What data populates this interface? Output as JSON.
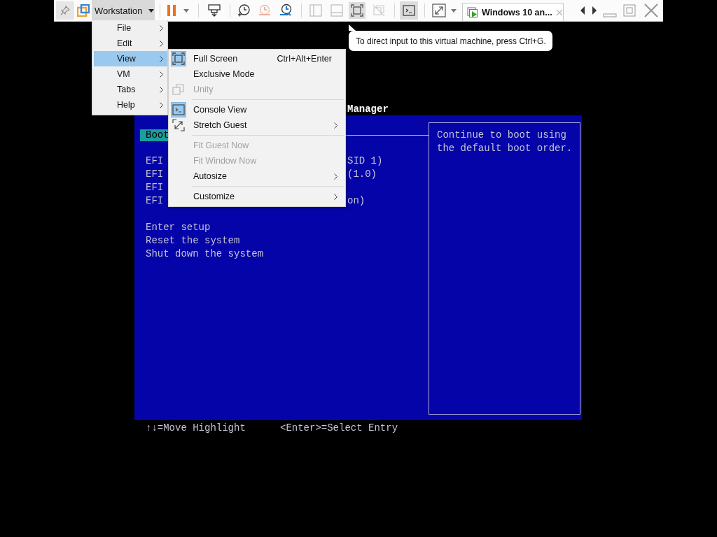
{
  "toolbar": {
    "app_menu_label": "Workstation",
    "tab": {
      "title": "Windows 10 an..."
    }
  },
  "app_menu": {
    "items": [
      {
        "label": "File",
        "selected": false
      },
      {
        "label": "Edit",
        "selected": false
      },
      {
        "label": "View",
        "selected": true
      },
      {
        "label": "VM",
        "selected": false
      },
      {
        "label": "Tabs",
        "selected": false
      },
      {
        "label": "Help",
        "selected": false
      }
    ]
  },
  "view_menu": {
    "items": [
      {
        "kind": "item",
        "label": "Full Screen",
        "shortcut": "Ctrl+Alt+Enter",
        "checked": true,
        "disabled": false,
        "submenu": false
      },
      {
        "kind": "item",
        "label": "Exclusive Mode",
        "checked": false,
        "disabled": false,
        "submenu": false
      },
      {
        "kind": "item",
        "label": "Unity",
        "checked": false,
        "disabled": true,
        "submenu": false
      },
      {
        "kind": "separator"
      },
      {
        "kind": "item",
        "label": "Console View",
        "checked": true,
        "disabled": false,
        "submenu": false
      },
      {
        "kind": "item",
        "label": "Stretch Guest",
        "checked": false,
        "disabled": false,
        "submenu": true
      },
      {
        "kind": "separator"
      },
      {
        "kind": "item",
        "label": "Fit Guest Now",
        "checked": false,
        "disabled": true,
        "submenu": false
      },
      {
        "kind": "item",
        "label": "Fit Window Now",
        "checked": false,
        "disabled": true,
        "submenu": false
      },
      {
        "kind": "item",
        "label": "Autosize",
        "checked": false,
        "disabled": false,
        "submenu": true
      },
      {
        "kind": "separator"
      },
      {
        "kind": "item",
        "label": "Customize",
        "checked": false,
        "disabled": false,
        "submenu": true
      }
    ]
  },
  "tooltip": {
    "text": "To direct input to this virtual machine, press Ctrl+G."
  },
  "boot_screen": {
    "title": "Manager",
    "highlighted_entry": "Boot",
    "entries": [
      {
        "label": "EFI",
        "tail": "SID 1)"
      },
      {
        "label": "EFI",
        "tail": "(1.0)"
      },
      {
        "label": "EFI"
      },
      {
        "label": "EFI",
        "tail": "on)"
      }
    ],
    "actions": [
      "Enter setup",
      "Reset the system",
      "Shut down the system"
    ],
    "help_text": "Continue to boot using the default boot order.",
    "footer": [
      "↑↓=Move Highlight",
      "<Enter>=Select Entry"
    ]
  }
}
